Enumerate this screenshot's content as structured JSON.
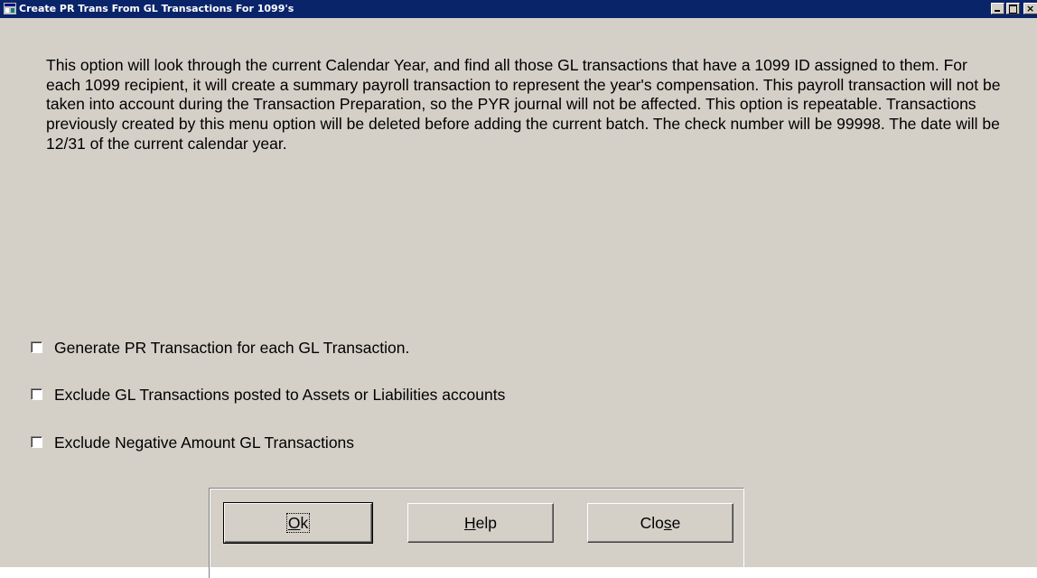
{
  "window": {
    "title": "Create PR Trans From GL Transactions For 1099's",
    "controls": [
      "minimize-icon",
      "maximize-icon",
      "close-icon"
    ]
  },
  "description": "This option will look through the current Calendar Year, and find all those GL transactions that have a 1099 ID assigned to them.  For each 1099 recipient, it will create a summary payroll transaction to represent the year's compensation.  This payroll transaction will not be taken into account during the Transaction Preparation, so the PYR journal will not be affected.  This option is repeatable.  Transactions previously created by this menu option will be deleted before adding the current batch.  The check number will be 99998.  The date will be 12/31 of the current calendar year.",
  "options": [
    {
      "label": "Generate PR Transaction for each GL Transaction.",
      "checked": false
    },
    {
      "label": "Exclude GL Transactions posted to Assets or Liabilities accounts",
      "checked": false
    },
    {
      "label": "Exclude Negative Amount GL Transactions",
      "checked": false
    }
  ],
  "buttons": {
    "ok": {
      "pre": "",
      "mnemonic": "O",
      "post": "k"
    },
    "help": {
      "pre": "",
      "mnemonic": "H",
      "post": "elp"
    },
    "close": {
      "pre": "Clo",
      "mnemonic": "s",
      "post": "e"
    }
  },
  "colors": {
    "titlebar": "#0a246a",
    "face": "#d4d0c8"
  }
}
